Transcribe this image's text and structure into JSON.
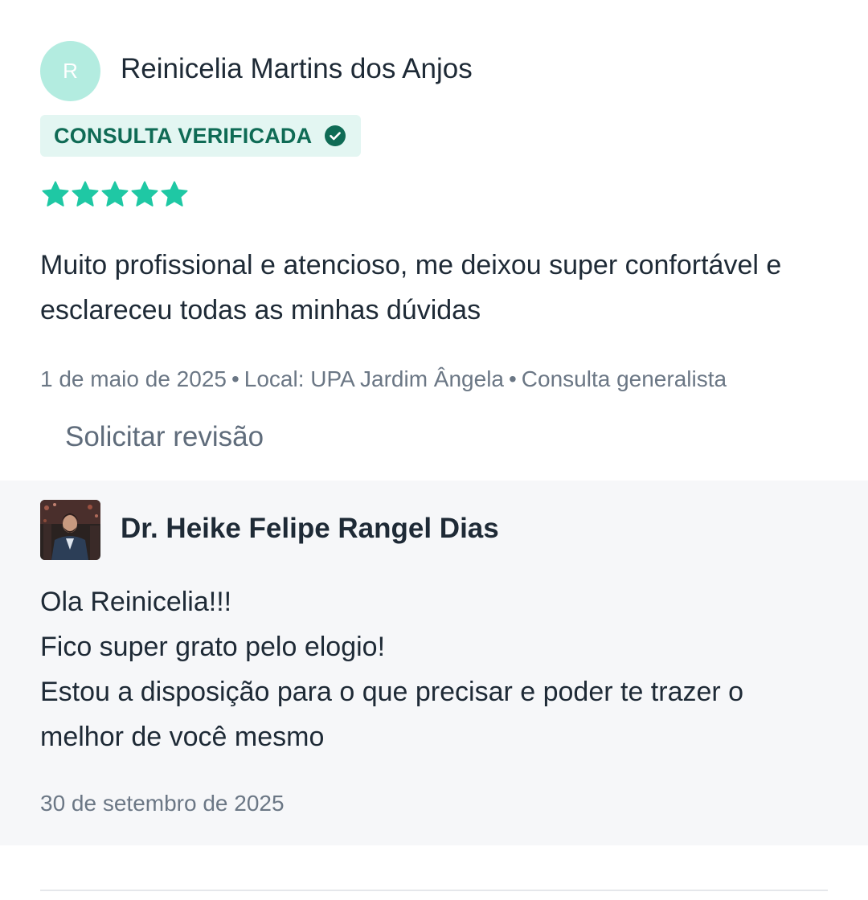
{
  "review": {
    "avatar_initial": "R",
    "reviewer_name": "Reinicelia Martins dos Anjos",
    "badge_label": "CONSULTA VERIFICADA",
    "rating": 5,
    "rating_max": 5,
    "text": "Muito profissional e atencioso, me deixou super confortável e esclareceu todas as minhas dúvidas",
    "meta": {
      "date": "1 de maio de 2025",
      "location": "Local: UPA Jardim Ângela",
      "service": "Consulta generalista",
      "separator": "•"
    },
    "request_review_label": "Solicitar revisão"
  },
  "reply": {
    "doctor_name": "Dr. Heike Felipe Rangel Dias",
    "lines": [
      "Ola Reinicelia!!!",
      "Fico super grato pelo elogio!",
      "Estou a disposição para o que precisar e poder te trazer o",
      "melhor de você mesmo"
    ],
    "date": "30 de setembro de 2025"
  },
  "colors": {
    "accent_green": "#1fc8a4",
    "badge_bg": "#e3f6f2",
    "badge_text": "#0f6b55",
    "reply_bg": "#f6f7f9",
    "avatar_bg": "#b3ece0"
  },
  "icons": {
    "verified": "check-circle-icon",
    "rating": "star-icon",
    "doctor_photo": "doctor-photo"
  }
}
